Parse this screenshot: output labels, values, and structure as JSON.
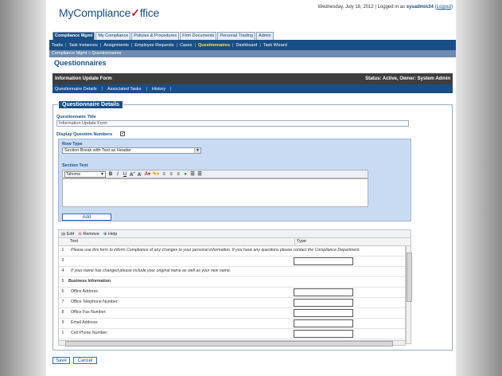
{
  "header": {
    "logo_text_1": "MyCompliance",
    "logo_check": "✓",
    "logo_text_2": "ffice",
    "date_text": "Wednesday, July 18, 2012 | Logged in as ",
    "username": "sysadmin34",
    "logout_label": "Logout"
  },
  "main_tabs": [
    "Compliance Mgmt",
    "My Compliance",
    "Policies & Procedures",
    "Firm Documents",
    "Personal Trading",
    "Admin"
  ],
  "sub_nav": [
    "Tasks",
    "Task Instances",
    "Assignments",
    "Employee Requests",
    "Cases",
    "Questionnaires",
    "Dashboard",
    "Task Wizard"
  ],
  "breadcrumb": "Compliance Mgmt »  Questionnaires",
  "page_title": "Questionnaires",
  "form_bar": {
    "title": "Information Update Form",
    "status": "Status: Active, Owner: System Admin"
  },
  "form_tabs": [
    "Questionnaire Details",
    "Associated Tasks",
    "History"
  ],
  "section": {
    "title": "Questionnaire Details",
    "title_label": "Questionnaire Title",
    "title_value": "Information Update Form",
    "display_numbers_label": "Display Question Numbers",
    "display_numbers_checked": "✓",
    "row_type_label": "Row Type",
    "row_type_value": "Section Break with Text as Header",
    "section_text_label": "Section Text",
    "font_value": "Tahoma",
    "add_label": "Add"
  },
  "grid": {
    "edit_label": "Edit",
    "remove_label": "Remove",
    "help_label": "Help",
    "col_text": "Text",
    "col_type": "Type",
    "rows": [
      {
        "num": "1",
        "text": "Please use this form to inform Compliance of any changes to your personal information. If you have any questions please contact the Compliance Department.",
        "style": "italic",
        "typebox": false
      },
      {
        "num": "3",
        "text": "",
        "style": "",
        "typebox": true
      },
      {
        "num": "4",
        "text": "If your name has changed please include your original name as well as your new name.",
        "style": "italic",
        "typebox": false
      },
      {
        "num": "5",
        "text": "Business Information",
        "style": "bold",
        "typebox": false
      },
      {
        "num": "6",
        "text": "Office Address:",
        "style": "",
        "typebox": true
      },
      {
        "num": "7",
        "text": "Office Telephone Number:",
        "style": "",
        "typebox": true
      },
      {
        "num": "8",
        "text": "Office Fax Number:",
        "style": "",
        "typebox": true
      },
      {
        "num": "9",
        "text": "Email Address:",
        "style": "",
        "typebox": true
      },
      {
        "num": "1",
        "text": "Cell Phone Number:",
        "style": "",
        "typebox": true
      }
    ]
  },
  "footer": {
    "save_label": "Save",
    "cancel_label": "Cancel"
  },
  "colors": {
    "brand_blue": "#1a4e86",
    "active_tab_text": "#ffe44f",
    "form_bar": "#3d3d3d",
    "row_panel": "#c9dbf3"
  }
}
